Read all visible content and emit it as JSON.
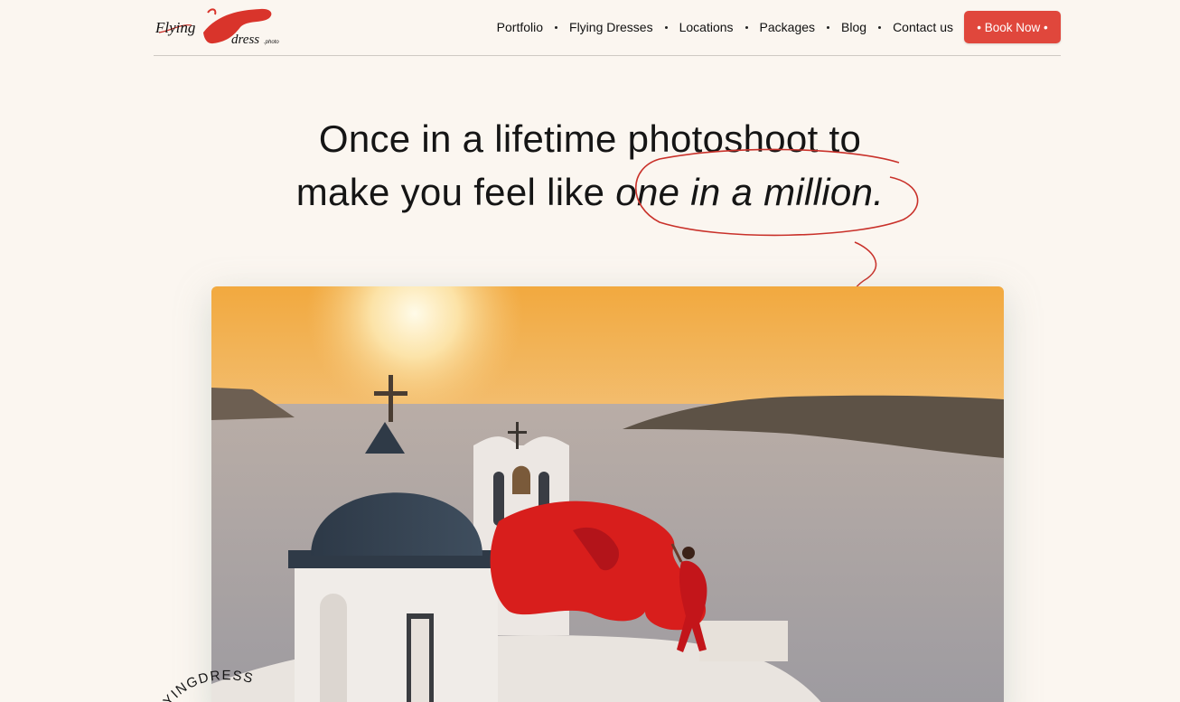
{
  "brand": {
    "logo_primary": "Flying",
    "logo_secondary": "dress",
    "logo_suffix": ".photo",
    "accent_color": "#e0473c"
  },
  "nav": {
    "items": [
      {
        "label": "Portfolio"
      },
      {
        "label": "Flying Dresses"
      },
      {
        "label": "Locations"
      },
      {
        "label": "Packages"
      },
      {
        "label": "Blog"
      },
      {
        "label": "Contact us"
      }
    ],
    "cta_label": "• Book Now •"
  },
  "hero": {
    "headline_line1": "Once in a lifetime photoshoot to",
    "headline_line2_prefix": "make you feel like ",
    "headline_emphasis": "one in a million.",
    "image_description_icon": "hero-photo"
  },
  "badge": {
    "text": "FLYINGDRESS"
  }
}
